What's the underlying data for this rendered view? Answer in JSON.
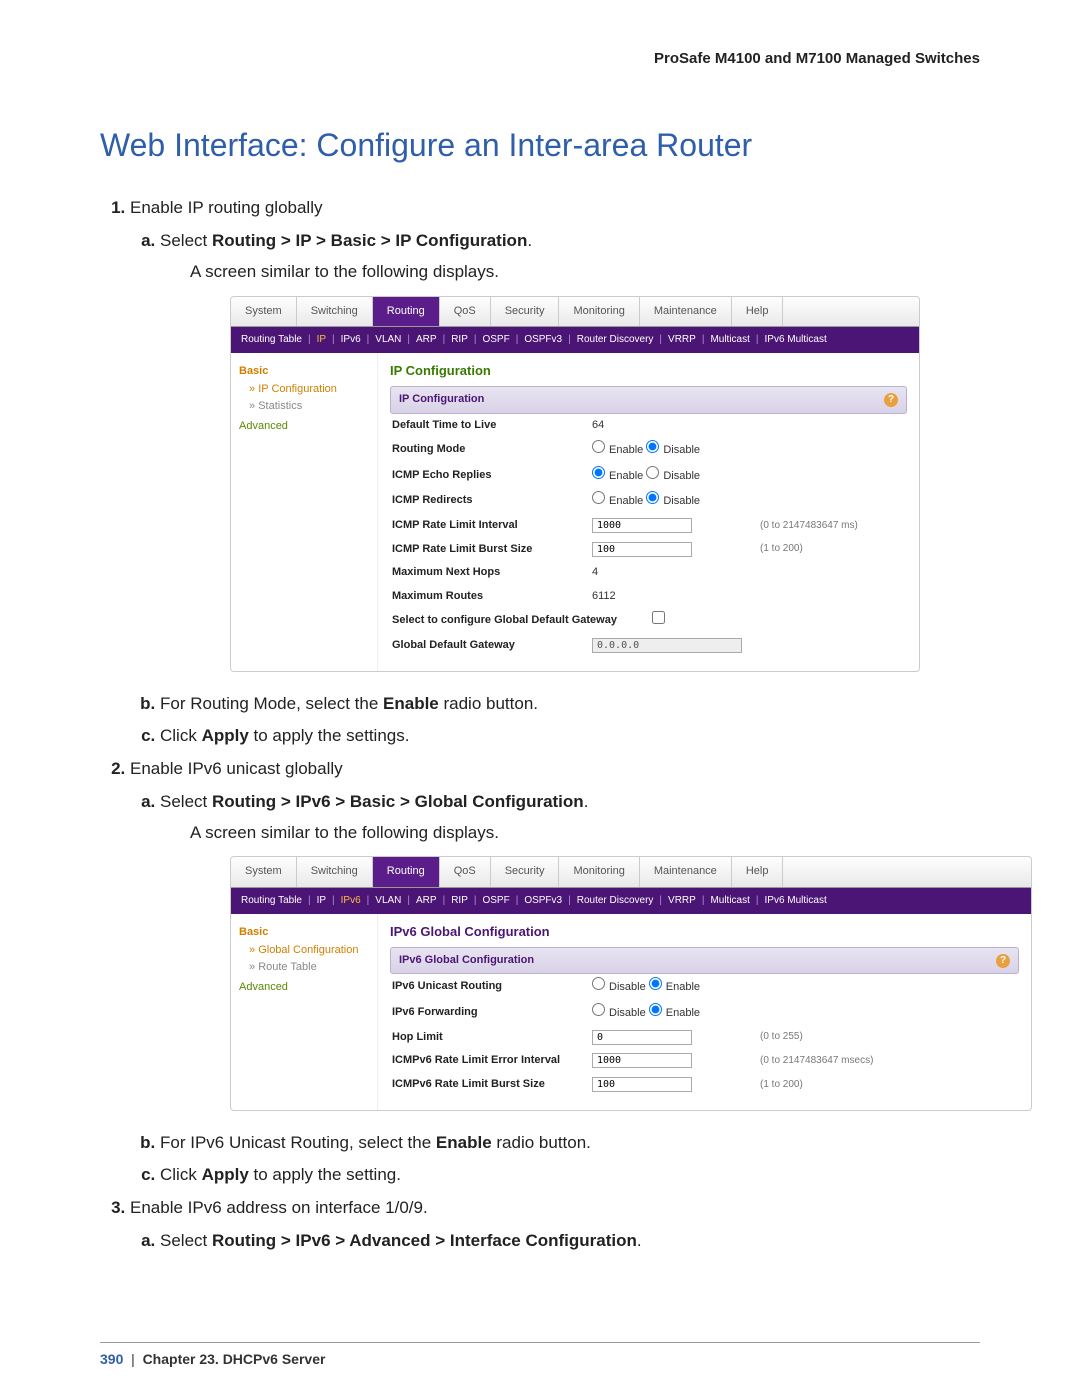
{
  "header": {
    "product": "ProSafe M4100 and M7100 Managed Switches"
  },
  "title": "Web Interface: Configure an Inter-area Router",
  "steps": {
    "s1": {
      "text": "Enable IP routing globally",
      "a_pre": "Select ",
      "a_bold": "Routing > IP > Basic > IP Configuration",
      "a_post": ".",
      "after_a": "A screen similar to the following displays.",
      "b_pre": "For Routing Mode, select the ",
      "b_bold": "Enable",
      "b_post": " radio button.",
      "c_pre": "Click ",
      "c_bold": "Apply",
      "c_post": " to apply the settings."
    },
    "s2": {
      "text": "Enable IPv6 unicast globally",
      "a_pre": "Select ",
      "a_bold": "Routing > IPv6 > Basic > Global Configuration",
      "a_post": ".",
      "after_a": "A screen similar to the following displays.",
      "b_pre": "For  IPv6 Unicast Routing, select the ",
      "b_bold": "Enable",
      "b_post": " radio button.",
      "c_pre": "Click ",
      "c_bold": "Apply",
      "c_post": " to apply the setting."
    },
    "s3": {
      "text": "Enable  IPv6 address on interface 1/0/9.",
      "a_pre": "Select ",
      "a_bold": "Routing > IPv6 > Advanced > Interface Configuration",
      "a_post": "."
    }
  },
  "shot1": {
    "tabs": {
      "System": "System",
      "Switching": "Switching",
      "Routing": "Routing",
      "QoS": "QoS",
      "Security": "Security",
      "Monitoring": "Monitoring",
      "Maintenance": "Maintenance",
      "Help": "Help"
    },
    "subnav": {
      "RoutingTable": "Routing Table",
      "IP": "IP",
      "IPv6": "IPv6",
      "VLAN": "VLAN",
      "ARP": "ARP",
      "RIP": "RIP",
      "OSPF": "OSPF",
      "OSPFv3": "OSPFv3",
      "RouterDiscovery": "Router Discovery",
      "VRRP": "VRRP",
      "Multicast": "Multicast",
      "IPv6Multicast": "IPv6 Multicast"
    },
    "sidebar": {
      "Basic": "Basic",
      "IPConfiguration": "IP Configuration",
      "Statistics": "Statistics",
      "Advanced": "Advanced"
    },
    "title": "IP Configuration",
    "barTitle": "IP Configuration",
    "rows": {
      "ttl": {
        "l": "Default Time to Live",
        "v": "64"
      },
      "mode": {
        "l": "Routing Mode",
        "e": "Enable",
        "d": "Disable"
      },
      "echo": {
        "l": "ICMP Echo Replies",
        "e": "Enable",
        "d": "Disable"
      },
      "redir": {
        "l": "ICMP Redirects",
        "e": "Enable",
        "d": "Disable"
      },
      "rli": {
        "l": "ICMP Rate Limit Interval",
        "v": "1000",
        "h": "(0 to 2147483647 ms)"
      },
      "rlb": {
        "l": "ICMP Rate Limit Burst Size",
        "v": "100",
        "h": "(1 to 200)"
      },
      "mnh": {
        "l": "Maximum Next Hops",
        "v": "4"
      },
      "mr": {
        "l": "Maximum Routes",
        "v": "6112"
      },
      "sgw": {
        "l": "Select to configure Global Default Gateway"
      },
      "gdw": {
        "l": "Global Default Gateway",
        "v": "0.0.0.0"
      }
    }
  },
  "shot2": {
    "sidebar": {
      "Basic": "Basic",
      "GlobalConfiguration": "Global Configuration",
      "RouteTable": "Route Table",
      "Advanced": "Advanced"
    },
    "title": "IPv6 Global Configuration",
    "barTitle": "IPv6 Global Configuration",
    "rows": {
      "ur": {
        "l": "IPv6 Unicast Routing",
        "d": "Disable",
        "e": "Enable"
      },
      "fwd": {
        "l": "IPv6 Forwarding",
        "d": "Disable",
        "e": "Enable"
      },
      "hop": {
        "l": "Hop Limit",
        "v": "0",
        "h": "(0 to 255)"
      },
      "rli": {
        "l": "ICMPv6 Rate Limit Error Interval",
        "v": "1000",
        "h": "(0 to 2147483647 msecs)"
      },
      "rlb": {
        "l": "ICMPv6 Rate Limit Burst Size",
        "v": "100",
        "h": "(1 to 200)"
      }
    }
  },
  "footer": {
    "page": "390",
    "sep": "|",
    "chapter": "Chapter 23.  DHCPv6 Server"
  }
}
